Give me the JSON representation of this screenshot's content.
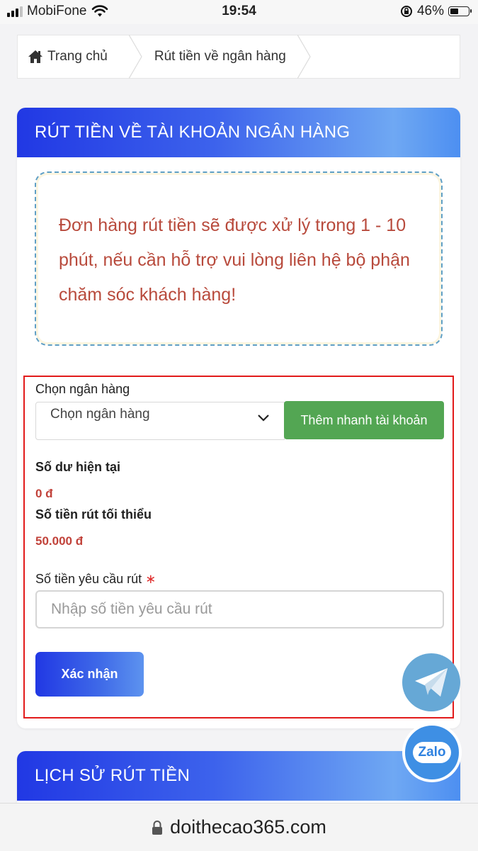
{
  "status_bar": {
    "carrier": "MobiFone",
    "time": "19:54",
    "battery": "46%",
    "battery_level": 0.46
  },
  "breadcrumb": {
    "home": "Trang chủ",
    "current": "Rút tiền về ngân hàng"
  },
  "withdraw_card": {
    "title": "RÚT TIỀN VỀ TÀI KHOẢN NGÂN HÀNG",
    "notice": "Đơn hàng rút tiền sẽ được xử lý trong 1 - 10 phút, nếu cần hỗ trợ vui lòng liên hệ bộ phận chăm sóc khách hàng!",
    "bank_label": "Chọn ngân hàng",
    "bank_select_value": "Chọn ngân hàng",
    "quick_add_button": "Thêm nhanh tài khoản",
    "balance_label": "Số dư hiện tại",
    "balance_value": "0 đ",
    "min_label": "Số tiền rút tối thiểu",
    "min_value": "50.000 đ",
    "amount_label": "Số tiền yêu cầu rút",
    "required_mark": "∗",
    "amount_placeholder": "Nhập số tiền yêu cầu rút",
    "submit_button": "Xác nhận"
  },
  "history_card": {
    "title": "LỊCH SỬ RÚT TIỀN"
  },
  "floating": {
    "zalo_label": "Zalo"
  },
  "browser": {
    "url": "doithecao365.com"
  },
  "colors": {
    "accent_blue": "#2138e4",
    "green_button": "#53a653",
    "notice_text": "#b84a3c",
    "highlight_border": "#e21a1a"
  }
}
